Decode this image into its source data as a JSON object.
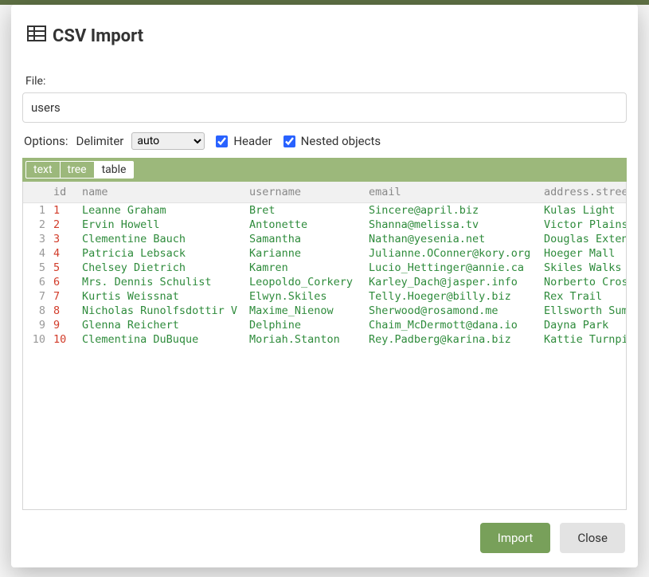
{
  "modal": {
    "title": "CSV Import",
    "file_label": "File:",
    "file_value": "users",
    "options_label": "Options:",
    "delimiter_label": "Delimiter",
    "delimiter_value": "auto",
    "delimiter_options": [
      "auto",
      ",",
      ";",
      "\\t",
      "|"
    ],
    "header_label": "Header",
    "header_checked": true,
    "nested_label": "Nested objects",
    "nested_checked": true,
    "tabs": {
      "text": "text",
      "tree": "tree",
      "table": "table",
      "active": "table"
    },
    "buttons": {
      "import": "Import",
      "close": "Close"
    }
  },
  "columns": [
    "id",
    "name",
    "username",
    "email",
    "address.street"
  ],
  "column_types": [
    "num",
    "str",
    "str",
    "str",
    "str"
  ],
  "rows": [
    {
      "n": 1,
      "id": 1,
      "name": "Leanne Graham",
      "username": "Bret",
      "email": "Sincere@april.biz",
      "address.street": "Kulas Light"
    },
    {
      "n": 2,
      "id": 2,
      "name": "Ervin Howell",
      "username": "Antonette",
      "email": "Shanna@melissa.tv",
      "address.street": "Victor Plains"
    },
    {
      "n": 3,
      "id": 3,
      "name": "Clementine Bauch",
      "username": "Samantha",
      "email": "Nathan@yesenia.net",
      "address.street": "Douglas Extension"
    },
    {
      "n": 4,
      "id": 4,
      "name": "Patricia Lebsack",
      "username": "Karianne",
      "email": "Julianne.OConner@kory.org",
      "address.street": "Hoeger Mall"
    },
    {
      "n": 5,
      "id": 5,
      "name": "Chelsey Dietrich",
      "username": "Kamren",
      "email": "Lucio_Hettinger@annie.ca",
      "address.street": "Skiles Walks"
    },
    {
      "n": 6,
      "id": 6,
      "name": "Mrs. Dennis Schulist",
      "username": "Leopoldo_Corkery",
      "email": "Karley_Dach@jasper.info",
      "address.street": "Norberto Crossing"
    },
    {
      "n": 7,
      "id": 7,
      "name": "Kurtis Weissnat",
      "username": "Elwyn.Skiles",
      "email": "Telly.Hoeger@billy.biz",
      "address.street": "Rex Trail"
    },
    {
      "n": 8,
      "id": 8,
      "name": "Nicholas Runolfsdottir V",
      "username": "Maxime_Nienow",
      "email": "Sherwood@rosamond.me",
      "address.street": "Ellsworth Summit"
    },
    {
      "n": 9,
      "id": 9,
      "name": "Glenna Reichert",
      "username": "Delphine",
      "email": "Chaim_McDermott@dana.io",
      "address.street": "Dayna Park"
    },
    {
      "n": 10,
      "id": 10,
      "name": "Clementina DuBuque",
      "username": "Moriah.Stanton",
      "email": "Rey.Padberg@karina.biz",
      "address.street": "Kattie Turnpike"
    }
  ]
}
